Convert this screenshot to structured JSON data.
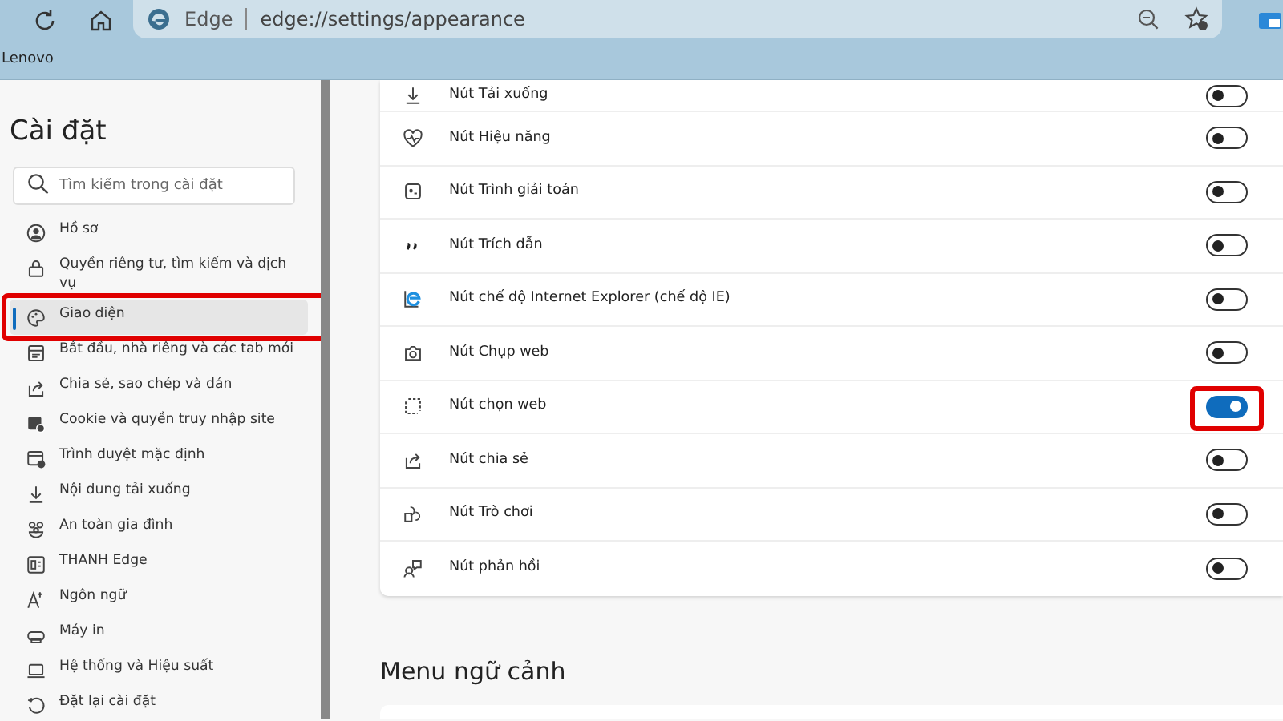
{
  "browser": {
    "site_label": "Edge",
    "address": "edge://settings/appearance",
    "bookmarks": [
      "Lenovo"
    ]
  },
  "sidebar": {
    "title": "Cài đặt",
    "search": {
      "placeholder": "Tìm kiếm trong cài đặt"
    },
    "items": [
      {
        "label": "Hồ sơ",
        "selected": false,
        "highlighted": false
      },
      {
        "label": "Quyền riêng tư, tìm kiếm và dịch vụ",
        "selected": false,
        "highlighted": false
      },
      {
        "label": "Giao diện",
        "selected": true,
        "highlighted": true
      },
      {
        "label": "Bắt đầu, nhà riêng và các tab mới",
        "selected": false,
        "highlighted": false
      },
      {
        "label": "Chia sẻ, sao chép và dán",
        "selected": false,
        "highlighted": false
      },
      {
        "label": "Cookie và quyền truy nhập site",
        "selected": false,
        "highlighted": false
      },
      {
        "label": "Trình duyệt mặc định",
        "selected": false,
        "highlighted": false
      },
      {
        "label": "Nội dung tải xuống",
        "selected": false,
        "highlighted": false
      },
      {
        "label": "An toàn gia đình",
        "selected": false,
        "highlighted": false
      },
      {
        "label": "THANH Edge",
        "selected": false,
        "highlighted": false
      },
      {
        "label": "Ngôn ngữ",
        "selected": false,
        "highlighted": false
      },
      {
        "label": "Máy in",
        "selected": false,
        "highlighted": false
      },
      {
        "label": "Hệ thống và Hiệu suất",
        "selected": false,
        "highlighted": false
      },
      {
        "label": "Đặt lại cài đặt",
        "selected": false,
        "highlighted": false
      }
    ]
  },
  "settings": [
    {
      "label": "Nút Tải xuống",
      "on": false,
      "highlighted": false
    },
    {
      "label": "Nút Hiệu năng",
      "on": false,
      "highlighted": false
    },
    {
      "label": "Nút Trình giải toán",
      "on": false,
      "highlighted": false
    },
    {
      "label": "Nút Trích dẫn",
      "on": false,
      "highlighted": false
    },
    {
      "label": "Nút chế độ Internet Explorer (chế độ IE)",
      "on": false,
      "highlighted": false
    },
    {
      "label": "Nút Chụp web",
      "on": false,
      "highlighted": false
    },
    {
      "label": "Nút chọn web",
      "on": true,
      "highlighted": true
    },
    {
      "label": "Nút chia sẻ",
      "on": false,
      "highlighted": false
    },
    {
      "label": "Nút Trò chơi",
      "on": false,
      "highlighted": false
    },
    {
      "label": "Nút phản hồi",
      "on": false,
      "highlighted": false
    }
  ],
  "next_section": {
    "title": "Menu ngữ cảnh"
  }
}
